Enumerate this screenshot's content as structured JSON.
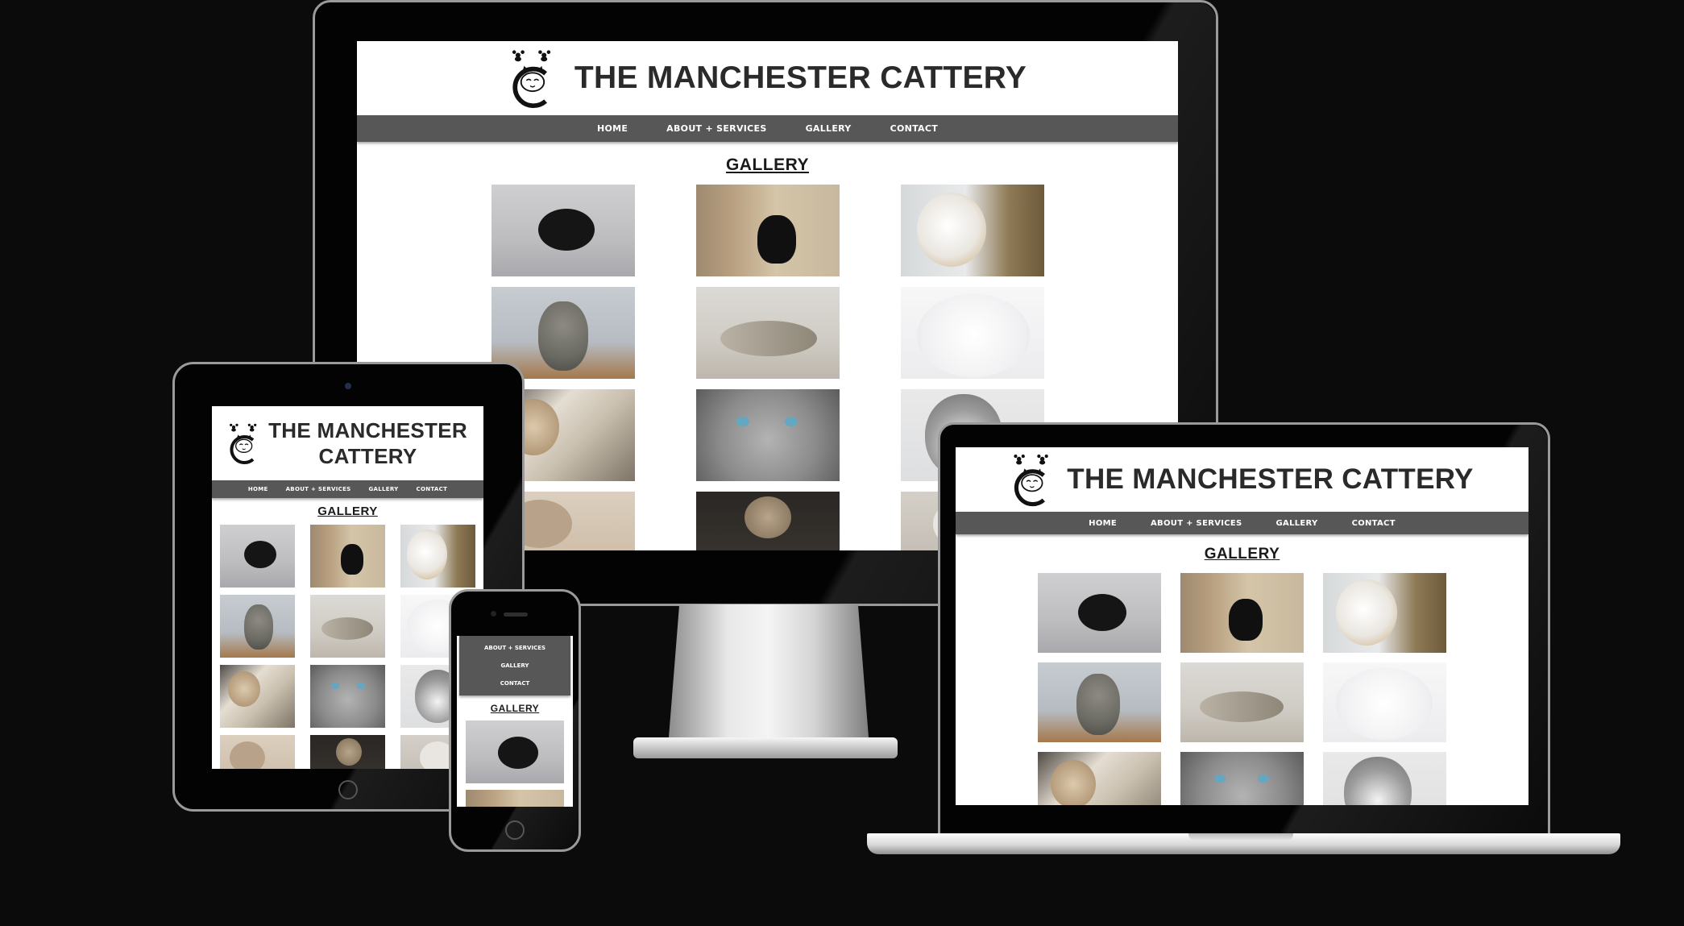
{
  "site": {
    "title": "THE MANCHESTER CATTERY",
    "tablet_title": "THE MANCHESTER\nCATTERY",
    "logo_icon": "cat-paw-logo-icon"
  },
  "nav": {
    "home": "HOME",
    "about": "ABOUT + SERVICES",
    "gallery": "GALLERY",
    "contact": "CONTACT"
  },
  "gallery": {
    "heading": "GALLERY",
    "photos": [
      "black-long-hair-cat-photo",
      "black-cat-scratching-post-photo",
      "calico-cat-photo",
      "tabby-cat-basket-photo",
      "lounging-tabby-cat-photo",
      "white-sleeping-cat-photo",
      "kitten-sunlight-photo",
      "grey-cat-blue-eyes-photo",
      "grey-white-cat-photo",
      "cream-cat-photo",
      "cats-on-blanket-photo",
      "cat-photo"
    ]
  },
  "colors": {
    "nav_bg": "#575757",
    "page_bg": "#0b0b0b",
    "title_text": "#2a2a2a"
  }
}
